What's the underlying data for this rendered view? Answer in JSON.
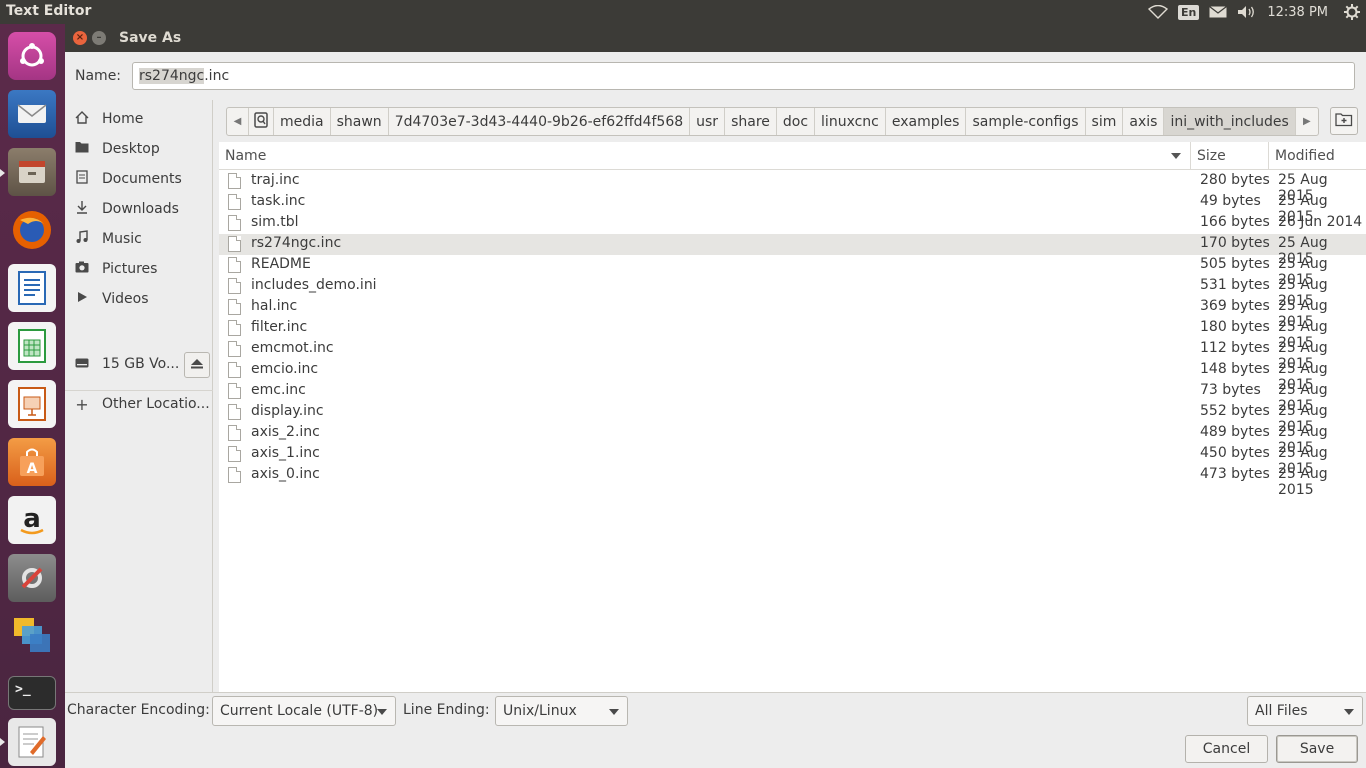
{
  "top_panel": {
    "app_title": "Text Editor",
    "keyboard_lang": "En",
    "clock": "12:38 PM"
  },
  "launcher": {
    "items": [
      {
        "name": "Ubuntu Dash",
        "icon": "ubuntu-logo-icon"
      },
      {
        "name": "Thunderbird Mail",
        "icon": "thunderbird-icon"
      },
      {
        "name": "Files",
        "icon": "files-icon"
      },
      {
        "name": "Firefox Web Browser",
        "icon": "firefox-icon"
      },
      {
        "name": "LibreOffice Writer",
        "icon": "writer-icon"
      },
      {
        "name": "LibreOffice Calc",
        "icon": "calc-icon"
      },
      {
        "name": "LibreOffice Impress",
        "icon": "impress-icon"
      },
      {
        "name": "Ubuntu Software",
        "icon": "software-center-icon"
      },
      {
        "name": "Amazon",
        "icon": "amazon-icon"
      },
      {
        "name": "System Settings",
        "icon": "settings-icon"
      },
      {
        "name": "Workspace Switcher",
        "icon": "workspaces-icon"
      },
      {
        "name": "Terminal",
        "icon": "terminal-icon"
      },
      {
        "name": "Text Editor",
        "icon": "text-editor-icon"
      }
    ]
  },
  "dialog": {
    "title": "Save As",
    "name_label": "Name:",
    "name_value_selected": "rs274ngc",
    "name_value_ext": ".inc"
  },
  "sidebar": {
    "items": [
      {
        "label": "Home",
        "icon": "home-icon"
      },
      {
        "label": "Desktop",
        "icon": "folder-icon"
      },
      {
        "label": "Documents",
        "icon": "documents-icon"
      },
      {
        "label": "Downloads",
        "icon": "downloads-icon"
      },
      {
        "label": "Music",
        "icon": "music-icon"
      },
      {
        "label": "Pictures",
        "icon": "pictures-icon"
      },
      {
        "label": "Videos",
        "icon": "videos-icon"
      }
    ],
    "volume_label": "15 GB Vo...",
    "other_label": "Other Locatio..."
  },
  "pathbar": {
    "crumbs": [
      "media",
      "shawn",
      "7d4703e7-3d43-4440-9b26-ef62ffd4f568",
      "usr",
      "share",
      "doc",
      "linuxcnc",
      "examples",
      "sample-configs",
      "sim",
      "axis",
      "ini_with_includes"
    ]
  },
  "filelist": {
    "columns": {
      "name": "Name",
      "size": "Size",
      "modified": "Modified"
    },
    "rows": [
      {
        "name": "traj.inc",
        "size": "280 bytes",
        "modified": "25 Aug 2015"
      },
      {
        "name": "task.inc",
        "size": "49 bytes",
        "modified": "25 Aug 2015"
      },
      {
        "name": "sim.tbl",
        "size": "166 bytes",
        "modified": "26 Jun 2014"
      },
      {
        "name": "rs274ngc.inc",
        "size": "170 bytes",
        "modified": "25 Aug 2015"
      },
      {
        "name": "README",
        "size": "505 bytes",
        "modified": "25 Aug 2015"
      },
      {
        "name": "includes_demo.ini",
        "size": "531 bytes",
        "modified": "25 Aug 2015"
      },
      {
        "name": "hal.inc",
        "size": "369 bytes",
        "modified": "25 Aug 2015"
      },
      {
        "name": "filter.inc",
        "size": "180 bytes",
        "modified": "25 Aug 2015"
      },
      {
        "name": "emcmot.inc",
        "size": "112 bytes",
        "modified": "25 Aug 2015"
      },
      {
        "name": "emcio.inc",
        "size": "148 bytes",
        "modified": "25 Aug 2015"
      },
      {
        "name": "emc.inc",
        "size": "73 bytes",
        "modified": "25 Aug 2015"
      },
      {
        "name": "display.inc",
        "size": "552 bytes",
        "modified": "25 Aug 2015"
      },
      {
        "name": "axis_2.inc",
        "size": "489 bytes",
        "modified": "25 Aug 2015"
      },
      {
        "name": "axis_1.inc",
        "size": "450 bytes",
        "modified": "25 Aug 2015"
      },
      {
        "name": "axis_0.inc",
        "size": "473 bytes",
        "modified": "25 Aug 2015"
      }
    ]
  },
  "options": {
    "encoding_label": "Character Encoding:",
    "encoding_value": "Current Locale (UTF-8)",
    "line_ending_label": "Line Ending:",
    "line_ending_value": "Unix/Linux",
    "filter_value": "All Files"
  },
  "actions": {
    "cancel_label": "Cancel",
    "save_label": "Save"
  }
}
